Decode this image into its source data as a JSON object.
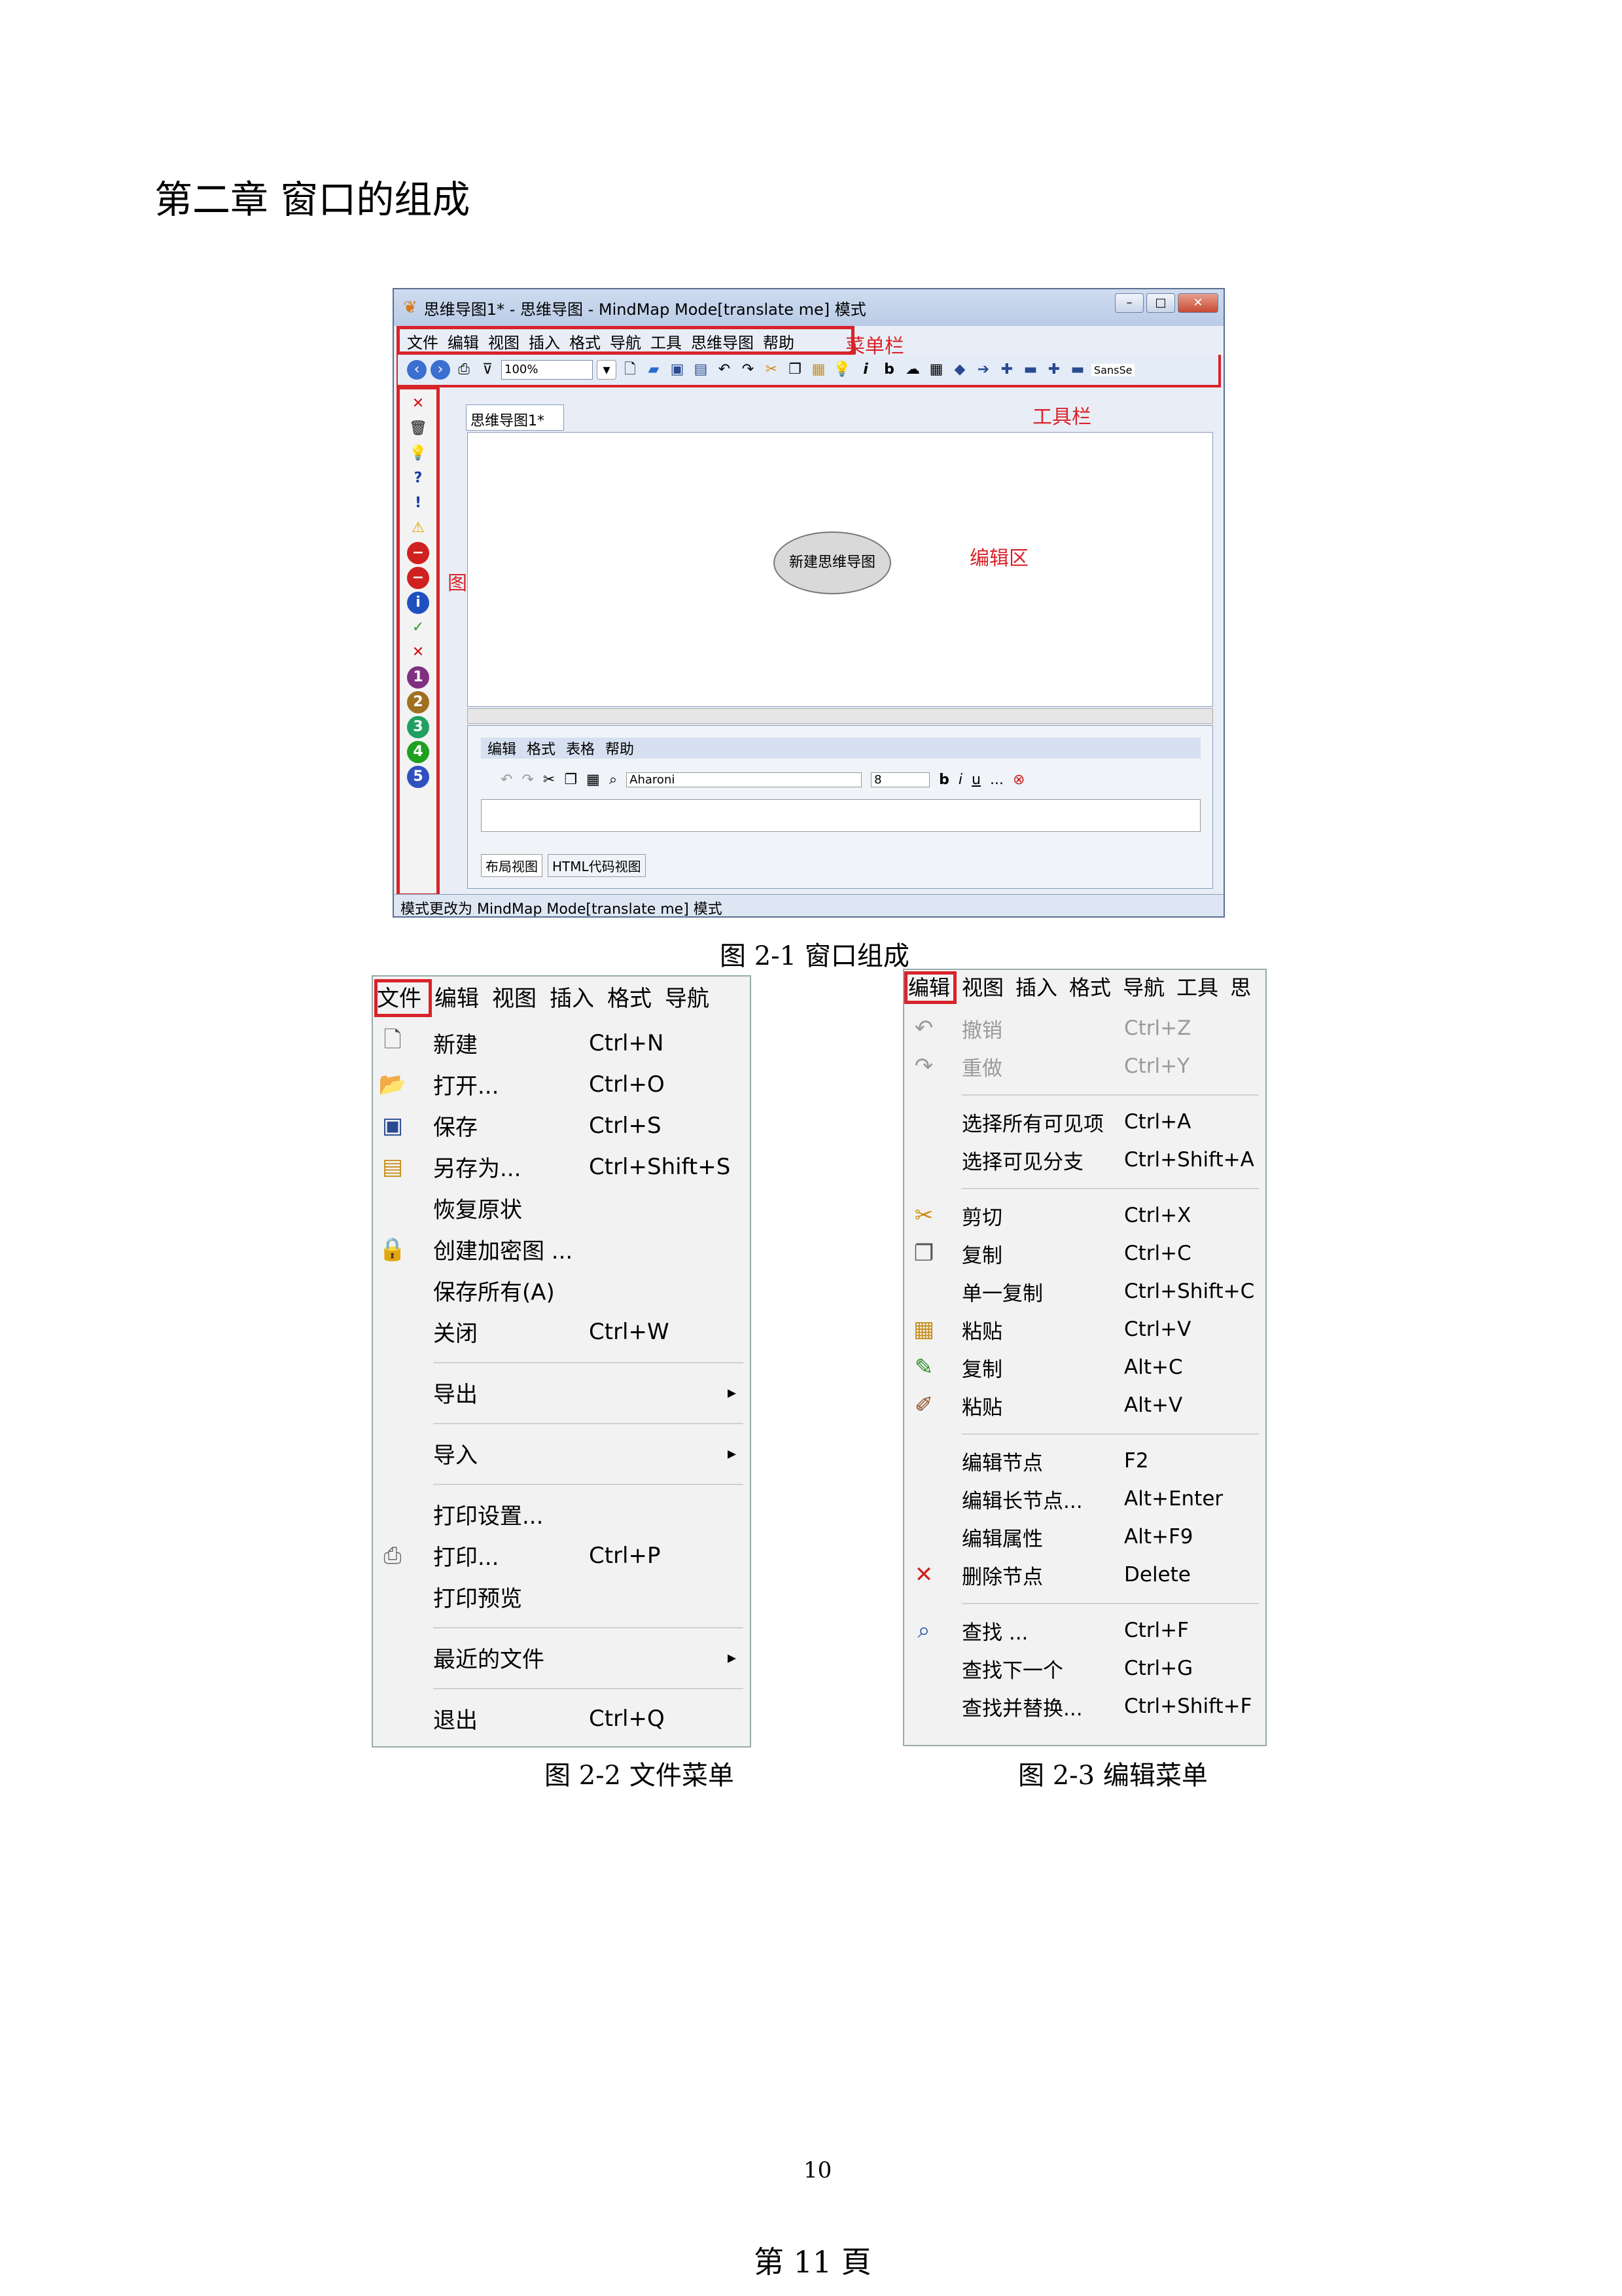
{
  "chapter_title": "第二章  窗口的组成",
  "fig1": {
    "window_title": "思维导图1* - 思维导图 - MindMap Mode[translate me] 模式",
    "menubar_items": [
      "文件",
      "编辑",
      "视图",
      "插入",
      "格式",
      "导航",
      "工具",
      "思维导图",
      "帮助"
    ],
    "label_menubar": "菜单栏",
    "label_toolbar": "工具栏",
    "label_iconbar": "图标栏",
    "label_editarea": "编辑区",
    "zoom": "100%",
    "font_name": "SansSe",
    "tab_name": "思维导图1*",
    "node_text": "新建思维导图",
    "editor_menu": [
      "编辑",
      "格式",
      "表格",
      "帮助"
    ],
    "editor_font": "Aharoni",
    "editor_size": "8",
    "view_tabs": [
      "布局视图",
      "HTML代码视图"
    ],
    "status": "模式更改为 MindMap Mode[translate me] 模式",
    "caption": "图 2-1 窗口组成"
  },
  "file_menu": {
    "top": [
      "文件",
      "编辑",
      "视图",
      "插入",
      "格式",
      "导航"
    ],
    "items": [
      {
        "label": "新建",
        "shortcut": "Ctrl+N",
        "icon": "new-doc"
      },
      {
        "label": "打开...",
        "shortcut": "Ctrl+O",
        "icon": "open-folder"
      },
      {
        "label": "保存",
        "shortcut": "Ctrl+S",
        "icon": "floppy"
      },
      {
        "label": "另存为...",
        "shortcut": "Ctrl+Shift+S",
        "icon": "save-as"
      },
      {
        "label": "恢复原状",
        "shortcut": "",
        "icon": ""
      },
      {
        "label": "创建加密图 ...",
        "shortcut": "",
        "icon": "lock"
      },
      {
        "label": "保存所有(A)",
        "shortcut": "",
        "icon": ""
      },
      {
        "label": "关闭",
        "shortcut": "Ctrl+W",
        "icon": ""
      },
      {
        "label": "导出",
        "shortcut": "",
        "icon": "",
        "submenu": true
      },
      {
        "label": "导入",
        "shortcut": "",
        "icon": "",
        "submenu": true
      },
      {
        "label": "打印设置...",
        "shortcut": "",
        "icon": ""
      },
      {
        "label": "打印...",
        "shortcut": "Ctrl+P",
        "icon": "printer"
      },
      {
        "label": "打印预览",
        "shortcut": "",
        "icon": ""
      },
      {
        "label": "最近的文件",
        "shortcut": "",
        "icon": "",
        "submenu": true
      },
      {
        "label": "退出",
        "shortcut": "Ctrl+Q",
        "icon": ""
      }
    ],
    "caption": "图 2-2 文件菜单"
  },
  "edit_menu": {
    "top": [
      "编辑",
      "视图",
      "插入",
      "格式",
      "导航",
      "工具",
      "思"
    ],
    "items": [
      {
        "label": "撤销",
        "shortcut": "Ctrl+Z",
        "icon": "undo",
        "disabled": true
      },
      {
        "label": "重做",
        "shortcut": "Ctrl+Y",
        "icon": "redo",
        "disabled": true
      },
      {
        "label": "选择所有可见项",
        "shortcut": "Ctrl+A",
        "icon": ""
      },
      {
        "label": "选择可见分支",
        "shortcut": "Ctrl+Shift+A",
        "icon": ""
      },
      {
        "label": "剪切",
        "shortcut": "Ctrl+X",
        "icon": "scissors"
      },
      {
        "label": "复制",
        "shortcut": "Ctrl+C",
        "icon": "copy"
      },
      {
        "label": "单一复制",
        "shortcut": "Ctrl+Shift+C",
        "icon": ""
      },
      {
        "label": "粘贴",
        "shortcut": "Ctrl+V",
        "icon": "paste"
      },
      {
        "label": "复制",
        "shortcut": "Alt+C",
        "icon": "pipette"
      },
      {
        "label": "粘贴",
        "shortcut": "Alt+V",
        "icon": "paint"
      },
      {
        "label": "编辑节点",
        "shortcut": "F2",
        "icon": ""
      },
      {
        "label": "编辑长节点...",
        "shortcut": "Alt+Enter",
        "icon": ""
      },
      {
        "label": "编辑属性",
        "shortcut": "Alt+F9",
        "icon": ""
      },
      {
        "label": "删除节点",
        "shortcut": "Delete",
        "icon": "delete"
      },
      {
        "label": "查找 ...",
        "shortcut": "Ctrl+F",
        "icon": "magnifier"
      },
      {
        "label": "查找下一个",
        "shortcut": "Ctrl+G",
        "icon": ""
      },
      {
        "label": "查找并替换...",
        "shortcut": "Ctrl+Shift+F",
        "icon": ""
      }
    ],
    "caption": "图 2-3 编辑菜单"
  },
  "page_number": "10",
  "page_footer": "第  11  頁"
}
